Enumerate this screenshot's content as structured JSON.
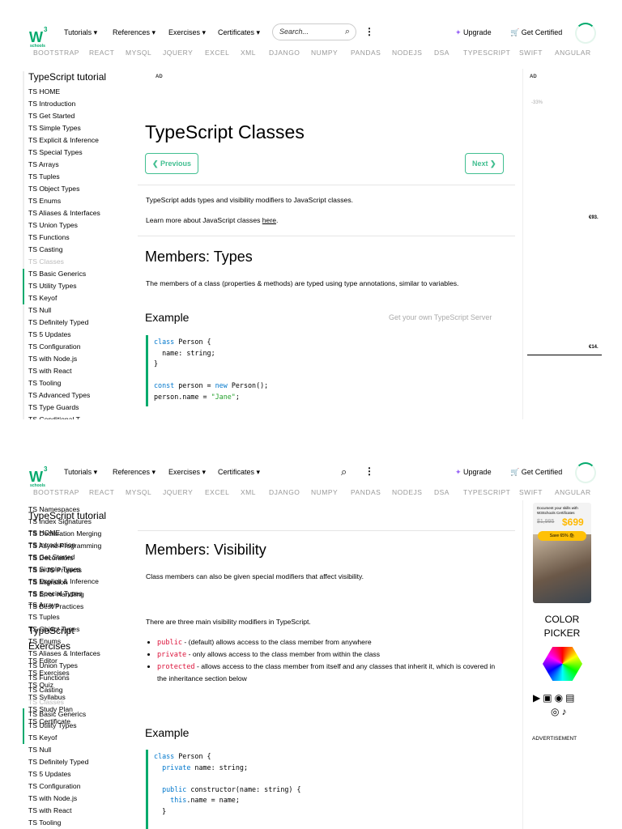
{
  "nav": {
    "tutorials": "Tutorials ▾",
    "references": "References ▾",
    "exercises": "Exercises ▾",
    "certificates": "Certificates ▾",
    "search_placeholder": "Search...",
    "upgrade": "Upgrade",
    "get_certified": "Get Certified",
    "logo_w": "W",
    "logo_3": "3",
    "logo_schools": "schools"
  },
  "subnav": [
    "BOOTSTRAP",
    "REACT",
    "MYSQL",
    "JQUERY",
    "EXCEL",
    "XML",
    "DJANGO",
    "NUMPY",
    "PANDAS",
    "NODEJS",
    "DSA",
    "TYPESCRIPT",
    "SWIFT",
    "ANGULAR"
  ],
  "sidebar": {
    "title": "TypeScript tutorial",
    "items": [
      "TS HOME",
      "TS Introduction",
      "TS Get Started",
      "TS Simple Types",
      "TS Explicit & Inference",
      "TS Special Types",
      "TS Arrays",
      "TS Tuples",
      "TS Object Types",
      "TS Enums",
      "TS Aliases & Interfaces",
      "TS Union Types",
      "TS Functions",
      "TS Casting",
      "TS Classes",
      "TS Basic Generics",
      "TS Utility Types",
      "TS Keyof",
      "TS Null",
      "TS Definitely Typed",
      "TS 5 Updates",
      "TS Configuration",
      "TS with Node.js",
      "TS with React",
      "TS Tooling",
      "TS Advanced Types",
      "TS Type Guards",
      "TS Conditional T..."
    ],
    "more_items": [
      "TS Namespaces",
      "TS Index Signatures",
      "TS Declaration Merging",
      "TS Async Programming",
      "TS Decorators",
      "TS in JS Projects",
      "TS Migration",
      "TS Error Handling",
      "TS Best Practices"
    ],
    "exercises_title": "TypeScript Exercises",
    "exercise_items": [
      "TS Editor",
      "TS Exercises",
      "TS Quiz",
      "TS Syllabus",
      "TS Study Plan",
      "TS Certificate"
    ]
  },
  "main": {
    "ad": "AD",
    "title": "TypeScript Classes",
    "previous": "❮ Previous",
    "next": "Next ❯",
    "intro": "TypeScript adds types and visibility modifiers to JavaScript classes.",
    "learn_more": "Learn more about JavaScript classes ",
    "here": "here",
    "learn_end": ".",
    "h_types": "Members: Types",
    "types_text": "The members of a class (properties & methods) are typed using type annotations, similar to variables.",
    "example": "Example",
    "get_server": "Get your own TypeScript Server",
    "h_vis": "Members: Visibility",
    "vis_text": "Class members can also be given special modifiers that affect visibility.",
    "three": "There are three main visibility modifiers in TypeScript.",
    "mods": [
      {
        "kw": "public",
        "text": " - (default) allows access to the class member from anywhere"
      },
      {
        "kw": "private",
        "text": " - only allows access to the class member from within the class"
      },
      {
        "kw": "protected",
        "text": " - allows access to the class member from itself and any classes that inherit it, which is covered in the inheritance section below"
      }
    ]
  },
  "right": {
    "ad": "AD",
    "discount": "-33%",
    "price1": "€93.",
    "price2": "€14.",
    "promo_text": "Document your skills with W3Schools Certificates",
    "old_price": "$1,995",
    "new_price": "$699",
    "save": "Save 65% 🛍",
    "color_picker": "COLOR PICKER",
    "advertisement": "ADVERTISEMENT"
  },
  "colors": {
    "accent": "#04aa6d",
    "keyword": "#0077cc",
    "string": "#22a02a",
    "modifier": "#dc143c",
    "upgrade": "#9763f6"
  }
}
